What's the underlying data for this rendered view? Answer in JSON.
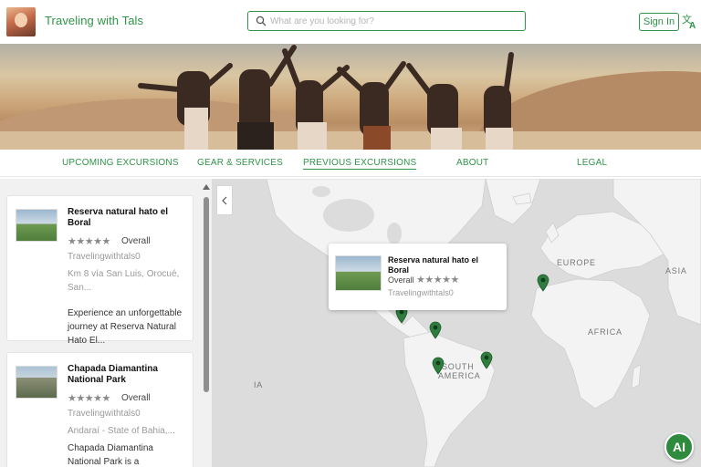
{
  "header": {
    "brand": "Traveling with Tals",
    "search_placeholder": "What are you looking for?",
    "signin_label": "Sign In"
  },
  "nav": {
    "items": [
      {
        "label": "UPCOMING EXCURSIONS"
      },
      {
        "label": "GEAR & SERVICES"
      },
      {
        "label": "PREVIOUS EXCURSIONS"
      },
      {
        "label": "ABOUT"
      },
      {
        "label": "LEGAL"
      }
    ],
    "active": "PREVIOUS EXCURSIONS"
  },
  "listings": [
    {
      "title": "Reserva natural hato el Boral",
      "stars": "★★★★★",
      "rating_label": "Overall",
      "author": "Travelingwithtals0",
      "address": "Km 8 vía San Luis, Orocué, San...",
      "description": "Experience an unforgettable journey at Reserva Natural Hato El..."
    },
    {
      "title": "Chapada Diamantina National Park",
      "stars": "★★★★★",
      "rating_label": "Overall",
      "author": "Travelingwithtals0",
      "address": "Andaraí - State of Bahia,...",
      "description": "Chapada Diamantina National Park is a breathtaking paradise..."
    }
  ],
  "map": {
    "labels": [
      "EUROPE",
      "ASIA",
      "AFRICA",
      "SOUTH",
      "AMERICA",
      "IA"
    ],
    "popup": {
      "title": "Reserva natural hato el Boral",
      "rating_label": "Overall",
      "stars": "★★★★★",
      "author": "Travelingwithtals0"
    }
  },
  "ai_button_label": "AI",
  "colors": {
    "accent": "#2e9448",
    "map_land": "#f3f3f3",
    "map_water": "#dcdcdc",
    "marker": "#2e7d3e"
  }
}
